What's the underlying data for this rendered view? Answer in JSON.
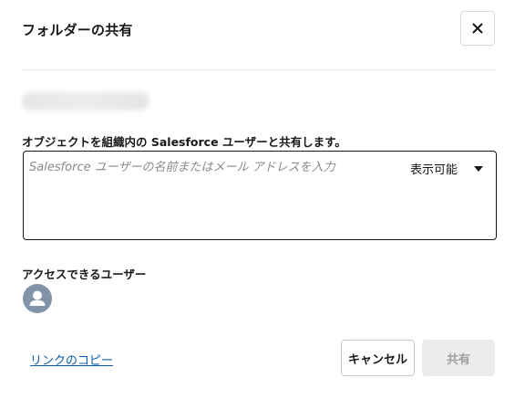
{
  "dialog": {
    "title": "フォルダーの共有",
    "close_icon": "close-icon"
  },
  "share": {
    "section_label": "オブジェクトを組織内の Salesforce ユーザーと共有します。",
    "input_placeholder": "Salesforce ユーザーの名前またはメール アドレスを入力",
    "input_value": "",
    "permission_selected": "表示可能",
    "permission_icon": "chevron-down-icon"
  },
  "access": {
    "label": "アクセスできるユーザー",
    "users": [
      {
        "avatar_icon": "user-avatar-icon"
      }
    ]
  },
  "footer": {
    "copy_link_label": "リンクのコピー",
    "cancel_label": "キャンセル",
    "share_label": "共有"
  },
  "colors": {
    "link": "#0b5cab",
    "avatar_bg": "#8193a8",
    "disabled_button_bg": "#ececec",
    "disabled_button_text": "#a0a0a0"
  }
}
